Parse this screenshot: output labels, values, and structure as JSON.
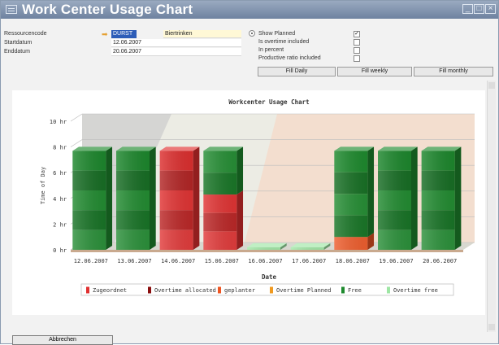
{
  "window": {
    "title": "Work Center Usage Chart"
  },
  "form": {
    "resource_label": "Ressourcencode",
    "resource_code": "DURST",
    "resource_name": "Biertrinken",
    "start_label": "Startdatum",
    "start_value": "12.06.2007",
    "end_label": "Enddatum",
    "end_value": "20.06.2007"
  },
  "options": [
    {
      "label": "Show Planned",
      "checked": true
    },
    {
      "label": "Is overtime included",
      "checked": false
    },
    {
      "label": "In percent",
      "checked": false
    },
    {
      "label": "Productive ratio included",
      "checked": false
    }
  ],
  "fill_buttons": {
    "daily": "Fill Daily",
    "weekly": "Fill weekly",
    "monthly": "Fill monthly"
  },
  "footer": {
    "cancel_label": "Abbrechen"
  },
  "colors": {
    "Zugeordnet": "#e03030",
    "Overtime allocated": "#8a0e0e",
    "geplanter": "#ee5522",
    "Overtime Planned": "#f09a20",
    "Free": "#1e8a2e",
    "Overtime free": "#9ee6a4"
  },
  "chart_data": {
    "type": "bar",
    "stacked": true,
    "title": "Workcenter Usage Chart",
    "xlabel": "Date",
    "ylabel": "Time of Day",
    "ylim": [
      0,
      10
    ],
    "yticks": [
      "0 hr",
      "2 hr",
      "4 hr",
      "6 hr",
      "8 hr",
      "10 hr"
    ],
    "categories": [
      "12.06.2007",
      "13.06.2007",
      "14.06.2007",
      "15.06.2007",
      "16.06.2007",
      "17.06.2007",
      "18.06.2007",
      "19.06.2007",
      "20.06.2007"
    ],
    "series": [
      {
        "name": "Zugeordnet",
        "values": [
          0,
          0,
          7.7,
          4.3,
          0,
          0,
          0,
          0,
          0
        ]
      },
      {
        "name": "Overtime allocated",
        "values": [
          0,
          0,
          0,
          0,
          0,
          0,
          0,
          0,
          0
        ]
      },
      {
        "name": "geplanter",
        "values": [
          0,
          0,
          0,
          0,
          0,
          0,
          1,
          0,
          0
        ]
      },
      {
        "name": "Overtime Planned",
        "values": [
          0,
          0,
          0,
          0,
          0,
          0,
          0,
          0,
          0
        ]
      },
      {
        "name": "Free",
        "values": [
          7.7,
          7.7,
          0,
          3.4,
          0,
          0,
          6.7,
          7.7,
          7.7
        ]
      },
      {
        "name": "Overtime free",
        "values": [
          0,
          0,
          0,
          0,
          0.2,
          0.2,
          0,
          0,
          0
        ]
      }
    ],
    "legend": [
      "Zugeordnet",
      "Overtime allocated",
      "geplanter",
      "Overtime Planned",
      "Free",
      "Overtime free"
    ],
    "legend_position": "bottom"
  }
}
